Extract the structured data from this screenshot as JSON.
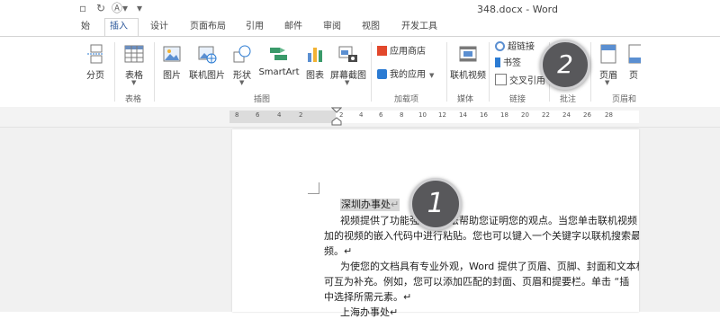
{
  "titlebar": {
    "document_title": "348.docx - Word"
  },
  "tabs": [
    "始",
    "插入",
    "设计",
    "页面布局",
    "引用",
    "邮件",
    "审阅",
    "视图",
    "开发工具"
  ],
  "ribbon": {
    "pages_btn": "分页",
    "table_btn": "表格",
    "table_group": "表格",
    "picture_btn": "图片",
    "online_picture_btn": "联机图片",
    "shapes_btn": "形状",
    "smartart_btn": "SmartArt",
    "chart_btn": "图表",
    "screenshot_btn": "屏幕截图",
    "illustrations_group": "插图",
    "store_btn": "应用商店",
    "my_apps_btn": "我的应用",
    "addins_group": "加载项",
    "online_video_btn": "联机视频",
    "media_group": "媒体",
    "hyperlink_btn": "超链接",
    "bookmark_btn": "书签",
    "crossref_btn": "交叉引用",
    "links_group": "链接",
    "comments_group": "批注",
    "header_btn": "页眉",
    "header_footer_group": "页眉和",
    "footer_btn": "页"
  },
  "ruler": {
    "ticks": [
      "8",
      "6",
      "4",
      "2",
      "2",
      "4",
      "6",
      "8",
      "10",
      "12",
      "14",
      "16",
      "18",
      "20",
      "22",
      "24",
      "26",
      "28"
    ]
  },
  "document": {
    "heading": "深圳办事处",
    "heading_mark": "↵",
    "lines": [
      "视频提供了功能强大的方法帮助您证明您的观点。当您单击联机视频",
      "加的视频的嵌入代码中进行粘贴。您也可以键入一个关键字以联机搜索最",
      "频。↵",
      "为使您的文档具有专业外观，Word 提供了页眉、页脚、封面和文本框",
      "可互为补充。例如，您可以添加匹配的封面、页眉和提要栏。单击 “插",
      "中选择所需元素。↵",
      "上海办事处↵"
    ]
  },
  "callouts": [
    "1",
    "2"
  ]
}
